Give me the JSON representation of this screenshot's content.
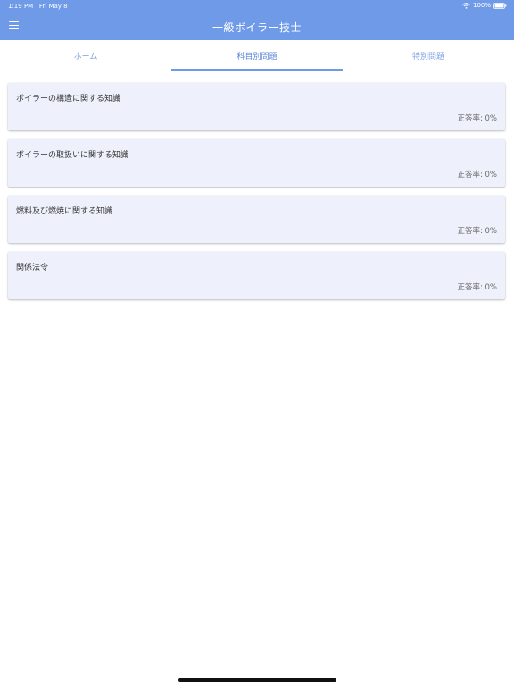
{
  "status_bar": {
    "time": "1:19 PM",
    "date": "Fri May 8",
    "battery": "100%"
  },
  "header": {
    "title": "一級ボイラー技士"
  },
  "tabs": [
    {
      "label": "ホーム",
      "active": false
    },
    {
      "label": "科目別問題",
      "active": true
    },
    {
      "label": "特別問題",
      "active": false
    }
  ],
  "subjects": [
    {
      "title": "ボイラーの構造に関する知識",
      "rate": "正答率: 0%"
    },
    {
      "title": "ボイラーの取扱いに関する知識",
      "rate": "正答率: 0%"
    },
    {
      "title": "燃料及び燃焼に関する知識",
      "rate": "正答率: 0%"
    },
    {
      "title": "関係法令",
      "rate": "正答率: 0%"
    }
  ],
  "colors": {
    "header_bg": "#6f9ae8",
    "card_bg": "#eef1fc",
    "tab_text": "#7ea0e4"
  },
  "icons": {
    "menu": "hamburger-menu-icon",
    "wifi": "wifi-icon",
    "battery": "battery-icon"
  }
}
